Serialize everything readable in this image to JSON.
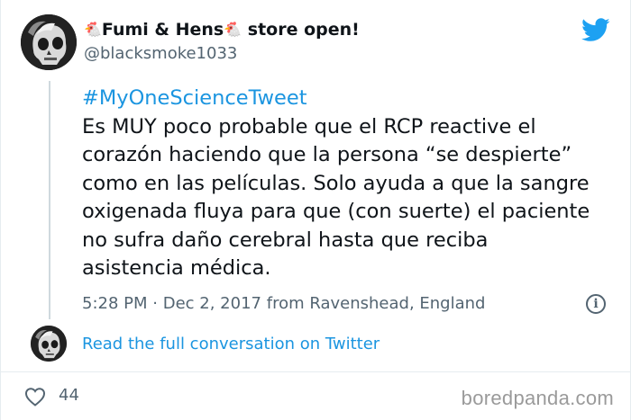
{
  "colors": {
    "link": "#1b95e0",
    "text": "#0f1419",
    "secondary": "#536471",
    "twitter_blue": "#1da1f2"
  },
  "author": {
    "name_part1": "Fumi & Hens",
    "name_part2": "store open!",
    "emoji": "🐔",
    "handle": "@blacksmoke1033",
    "avatar_icon": "skull-avatar-icon"
  },
  "tweet": {
    "hashtag": "#MyOneScienceTweet",
    "text": "Es MUY poco probable que el RCP reactive el\ncorazón haciendo que la persona “se despierte”\ncomo en las películas. Solo ayuda a que la sangre\noxigenada fluya para que (con suerte) el paciente\nno sufra daño cerebral hasta que reciba\nasistencia médica.",
    "time": "5:28 PM",
    "separator": "·",
    "date": "Dec 2, 2017",
    "location": "from Ravenshead, England"
  },
  "actions": {
    "read_conversation": "Read the full conversation on Twitter",
    "likes": "44"
  },
  "watermark": "boredpanda.com",
  "icons": [
    "twitter-bird-icon",
    "info-icon",
    "heart-icon"
  ]
}
